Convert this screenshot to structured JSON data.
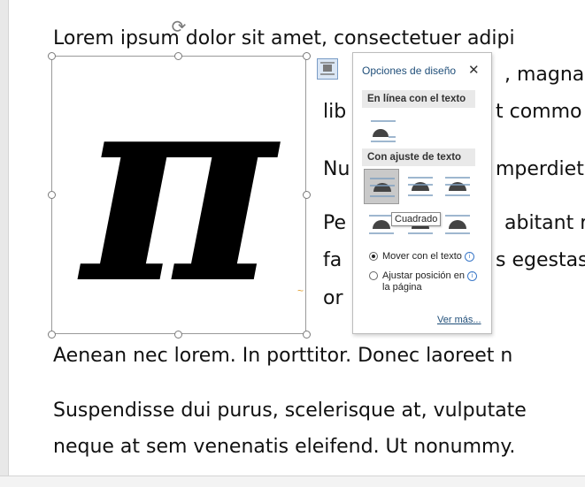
{
  "document": {
    "lines": [
      "Lorem ipsum dolor sit amet, consectetuer adipi",
      ", magna",
      "lib",
      "t commo",
      "Nu",
      "mperdiet",
      "Pe",
      "abitant r",
      "fa",
      "s egestas",
      "or",
      "Aenean nec lorem. In porttitor. Donec laoreet n",
      "Suspendisse dui purus, scelerisque at, vulputate",
      "neque at sem venenatis eleifend. Ut nonummy."
    ],
    "image_glyph": "π"
  },
  "layout_options": {
    "title": "Opciones de diseño",
    "close_glyph": "✕",
    "inline_section": "En línea con el texto",
    "wrap_section": "Con ajuste de texto",
    "tooltip": "Cuadrado",
    "move_with_text": "Mover con el texto",
    "fix_position_line1": "Ajustar posición en",
    "fix_position_line2": "la página",
    "see_more": "Ver más...",
    "info_glyph": "i"
  }
}
